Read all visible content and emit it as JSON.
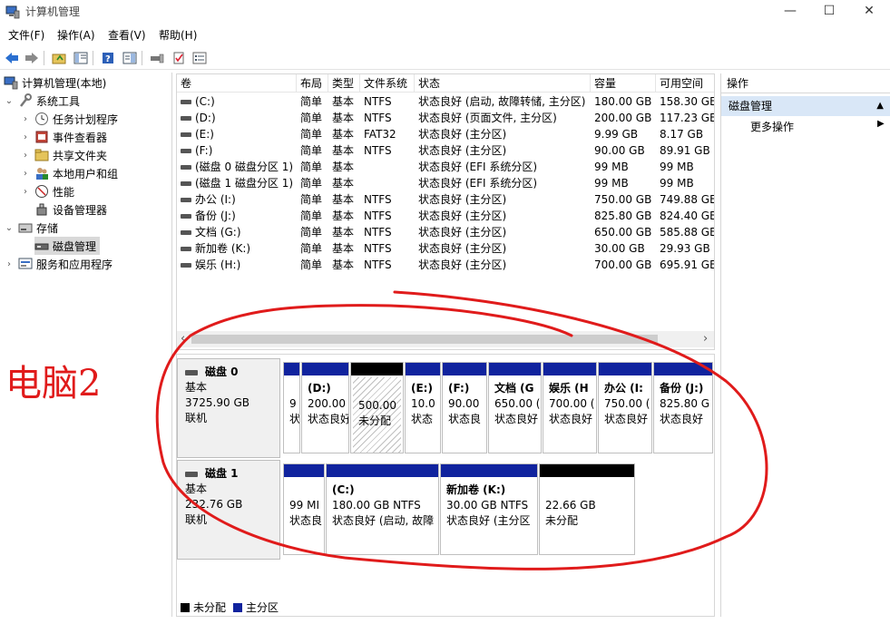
{
  "window": {
    "title": "计算机管理",
    "min": "—",
    "max": "☐",
    "close": "✕"
  },
  "menu": [
    "文件(F)",
    "操作(A)",
    "查看(V)",
    "帮助(H)"
  ],
  "tree": {
    "root": "计算机管理(本地)",
    "system_tools": "系统工具",
    "task_scheduler": "任务计划程序",
    "event_viewer": "事件查看器",
    "shared_folders": "共享文件夹",
    "local_users": "本地用户和组",
    "performance": "性能",
    "device_manager": "设备管理器",
    "storage": "存储",
    "disk_management": "磁盘管理",
    "services": "服务和应用程序"
  },
  "columns": [
    "卷",
    "布局",
    "类型",
    "文件系统",
    "状态",
    "容量",
    "可用空间"
  ],
  "volumes": [
    [
      "(C:)",
      "简单",
      "基本",
      "NTFS",
      "状态良好 (启动, 故障转储, 主分区)",
      "180.00 GB",
      "158.30 GB"
    ],
    [
      "(D:)",
      "简单",
      "基本",
      "NTFS",
      "状态良好 (页面文件, 主分区)",
      "200.00 GB",
      "117.23 GB"
    ],
    [
      "(E:)",
      "简单",
      "基本",
      "FAT32",
      "状态良好 (主分区)",
      "9.99 GB",
      "8.17 GB"
    ],
    [
      "(F:)",
      "简单",
      "基本",
      "NTFS",
      "状态良好 (主分区)",
      "90.00 GB",
      "89.91 GB"
    ],
    [
      "(磁盘 0 磁盘分区 1)",
      "简单",
      "基本",
      "",
      "状态良好 (EFI 系统分区)",
      "99 MB",
      "99 MB"
    ],
    [
      "(磁盘 1 磁盘分区 1)",
      "简单",
      "基本",
      "",
      "状态良好 (EFI 系统分区)",
      "99 MB",
      "99 MB"
    ],
    [
      "办公 (I:)",
      "简单",
      "基本",
      "NTFS",
      "状态良好 (主分区)",
      "750.00 GB",
      "749.88 GB"
    ],
    [
      "备份 (J:)",
      "简单",
      "基本",
      "NTFS",
      "状态良好 (主分区)",
      "825.80 GB",
      "824.40 GB"
    ],
    [
      "文档 (G:)",
      "简单",
      "基本",
      "NTFS",
      "状态良好 (主分区)",
      "650.00 GB",
      "585.88 GB"
    ],
    [
      "新加卷 (K:)",
      "简单",
      "基本",
      "NTFS",
      "状态良好 (主分区)",
      "30.00 GB",
      "29.93 GB"
    ],
    [
      "娱乐 (H:)",
      "简单",
      "基本",
      "NTFS",
      "状态良好 (主分区)",
      "700.00 GB",
      "695.91 GB"
    ]
  ],
  "scroll": {
    "left": "‹",
    "right": "›"
  },
  "disk0": {
    "name": "磁盘 0",
    "type": "基本",
    "size": "3725.90 GB",
    "status": "联机",
    "partitions": [
      {
        "name": "",
        "size": "9",
        "status": "状",
        "kind": "primary"
      },
      {
        "name": "(D:)",
        "size": "200.00",
        "status": "状态良好",
        "kind": "primary"
      },
      {
        "name": "",
        "size": "500.00",
        "status": "未分配",
        "kind": "unalloc"
      },
      {
        "name": "(E:)",
        "size": "10.0",
        "status": "状态",
        "kind": "primary"
      },
      {
        "name": "(F:)",
        "size": "90.00",
        "status": "状态良",
        "kind": "primary"
      },
      {
        "name": "文档 (G",
        "size": "650.00 (",
        "status": "状态良好",
        "kind": "primary"
      },
      {
        "name": "娱乐 (H",
        "size": "700.00 (",
        "status": "状态良好",
        "kind": "primary"
      },
      {
        "name": "办公 (I:",
        "size": "750.00 (",
        "status": "状态良好",
        "kind": "primary"
      },
      {
        "name": "备份 (J:)",
        "size": "825.80 G",
        "status": "状态良好",
        "kind": "primary"
      }
    ]
  },
  "disk1": {
    "name": "磁盘 1",
    "type": "基本",
    "size": "232.76 GB",
    "status": "联机",
    "partitions": [
      {
        "name": "",
        "size": "99 MI",
        "status": "状态良",
        "kind": "primary"
      },
      {
        "name": "(C:)",
        "size": "180.00 GB NTFS",
        "status": "状态良好 (启动, 故障",
        "kind": "primary"
      },
      {
        "name": "新加卷 (K:)",
        "size": "30.00 GB NTFS",
        "status": "状态良好 (主分区",
        "kind": "primary"
      },
      {
        "name": "",
        "size": "22.66 GB",
        "status": "未分配",
        "kind": "unalloc"
      }
    ]
  },
  "legend": {
    "unallocated": "未分配",
    "primary": "主分区"
  },
  "actions": {
    "header": "操作",
    "section": "磁盘管理",
    "more": "更多操作"
  },
  "annotation": "电脑2",
  "colors": {
    "primary_bar": "#10239e",
    "unallocated_bar": "#000000",
    "annotation": "#e01b1b",
    "selection": "#d9e7f7"
  }
}
